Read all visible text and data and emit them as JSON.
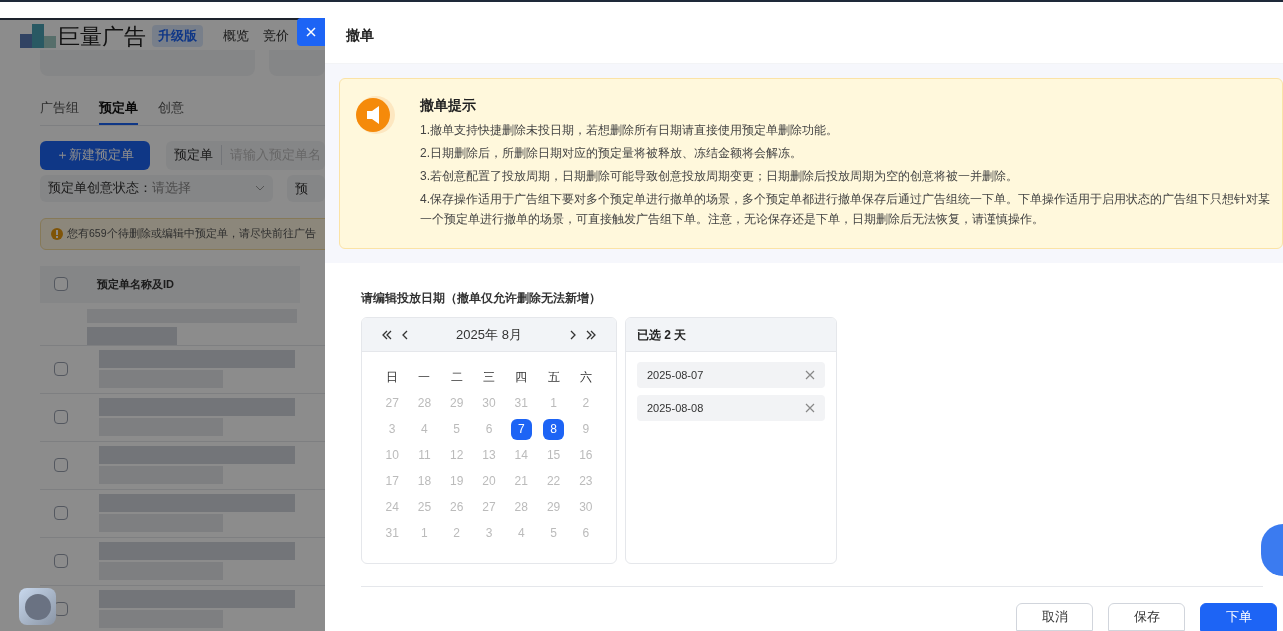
{
  "background_page": {
    "logo_text": "巨量广告",
    "edition_badge": "升级版",
    "nav": [
      "概览",
      "竞价"
    ],
    "tabs": [
      {
        "label": "广告组",
        "selected": false
      },
      {
        "label": "预定单",
        "selected": true
      },
      {
        "label": "创意",
        "selected": false
      }
    ],
    "new_button": "＋新建预定单",
    "search_type": "预定单",
    "search_placeholder": "请输入预定单名",
    "filter_label": "预定单创意状态：",
    "filter_placeholder": "请选择",
    "filter_2": "预",
    "alert": "您有659个待删除或编辑中预定单，请尽快前往广告",
    "table": {
      "columns": [
        "预定单名称及ID"
      ],
      "header_checked": false,
      "rows": [
        {
          "checked": false
        },
        {
          "checked": false
        },
        {
          "checked": false
        },
        {
          "checked": false
        },
        {
          "checked": false
        },
        {
          "checked": false
        }
      ]
    }
  },
  "drawer": {
    "title": "撤单",
    "notice": {
      "title": "撤单提示",
      "lines": [
        "1.撤单支持快捷删除未投日期，若想删除所有日期请直接使用预定单删除功能。",
        "2.日期删除后，所删除日期对应的预定量将被释放、冻结金额将会解冻。",
        "3.若创意配置了投放周期，日期删除可能导致创意投放周期变更；日期删除后投放周期为空的创意将被一并删除。",
        "4.保存操作适用于广告组下要对多个预定单进行撤单的场景，多个预定单都进行撤单保存后通过广告组统一下单。下单操作适用于启用状态的广告组下只想针对某一个预定单进行撤单的场景，可直接触发广告组下单。注意，无论保存还是下单，日期删除后无法恢复，请谨慎操作。"
      ]
    },
    "section_label": "请编辑投放日期（撤单仅允许删除无法新增）",
    "calendar": {
      "month": "2025年 8月",
      "weekdays": [
        "日",
        "一",
        "二",
        "三",
        "四",
        "五",
        "六"
      ],
      "days": [
        {
          "label": "27",
          "selected": false
        },
        {
          "label": "28",
          "selected": false
        },
        {
          "label": "29",
          "selected": false
        },
        {
          "label": "30",
          "selected": false
        },
        {
          "label": "31",
          "selected": false
        },
        {
          "label": "1",
          "selected": false
        },
        {
          "label": "2",
          "selected": false
        },
        {
          "label": "3",
          "selected": false
        },
        {
          "label": "4",
          "selected": false
        },
        {
          "label": "5",
          "selected": false
        },
        {
          "label": "6",
          "selected": false
        },
        {
          "label": "7",
          "selected": true
        },
        {
          "label": "8",
          "selected": true
        },
        {
          "label": "9",
          "selected": false
        },
        {
          "label": "10",
          "selected": false
        },
        {
          "label": "11",
          "selected": false
        },
        {
          "label": "12",
          "selected": false
        },
        {
          "label": "13",
          "selected": false
        },
        {
          "label": "14",
          "selected": false
        },
        {
          "label": "15",
          "selected": false
        },
        {
          "label": "16",
          "selected": false
        },
        {
          "label": "17",
          "selected": false
        },
        {
          "label": "18",
          "selected": false
        },
        {
          "label": "19",
          "selected": false
        },
        {
          "label": "20",
          "selected": false
        },
        {
          "label": "21",
          "selected": false
        },
        {
          "label": "22",
          "selected": false
        },
        {
          "label": "23",
          "selected": false
        },
        {
          "label": "24",
          "selected": false
        },
        {
          "label": "25",
          "selected": false
        },
        {
          "label": "26",
          "selected": false
        },
        {
          "label": "27",
          "selected": false
        },
        {
          "label": "28",
          "selected": false
        },
        {
          "label": "29",
          "selected": false
        },
        {
          "label": "30",
          "selected": false
        },
        {
          "label": "31",
          "selected": false
        },
        {
          "label": "1",
          "selected": false
        },
        {
          "label": "2",
          "selected": false
        },
        {
          "label": "3",
          "selected": false
        },
        {
          "label": "4",
          "selected": false
        },
        {
          "label": "5",
          "selected": false
        },
        {
          "label": "6",
          "selected": false
        }
      ]
    },
    "selected_panel": {
      "title": "已选 2 天",
      "dates": [
        "2025-08-07",
        "2025-08-08"
      ]
    },
    "buttons": [
      {
        "label": "取消",
        "kind": "default"
      },
      {
        "label": "保存",
        "kind": "default"
      },
      {
        "label": "下单",
        "kind": "primary"
      }
    ]
  }
}
